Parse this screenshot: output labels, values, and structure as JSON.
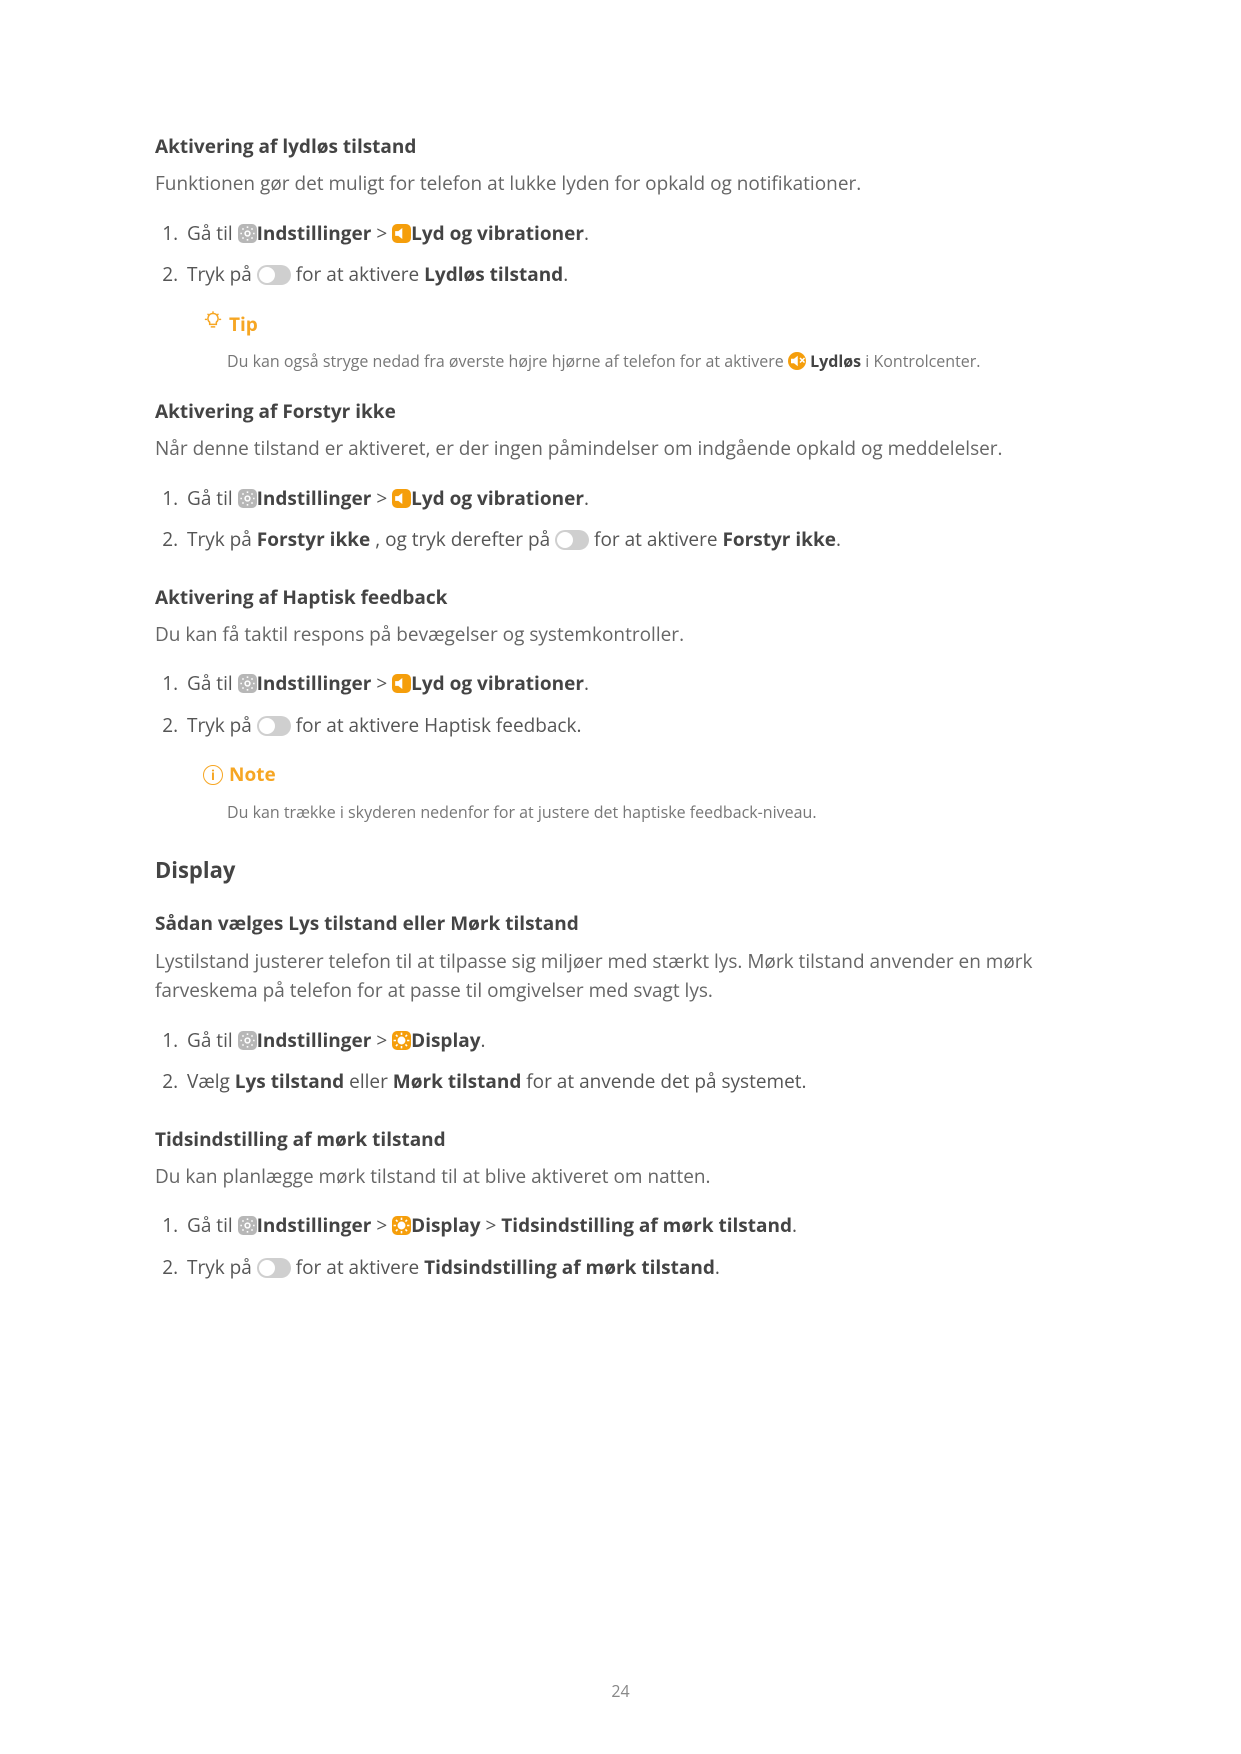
{
  "section1": {
    "heading": "Aktivering af lydløs tilstand",
    "body": "Funktionen gør det muligt for telefon at lukke lyden for opkald og notifikationer.",
    "step1_a": "Gå til ",
    "step1_b": "Indstillinger",
    "step1_sep": " > ",
    "step1_c": "Lyd og vibrationer",
    "step1_end": ".",
    "step2_a": "Tryk på ",
    "step2_b": " for at aktivere ",
    "step2_c": "Lydløs tilstand",
    "step2_end": ".",
    "tip_label": "Tip",
    "tip_a": "Du kan også stryge nedad fra øverste højre hjørne af telefon for at aktivere ",
    "tip_b": "Lydløs",
    "tip_c": " i Kontrolcenter."
  },
  "section2": {
    "heading": "Aktivering af Forstyr ikke",
    "body": "Når denne tilstand er aktiveret, er der ingen påmindelser om indgående opkald og meddelelser.",
    "step1_a": "Gå til ",
    "step1_b": "Indstillinger",
    "step1_sep": " > ",
    "step1_c": "Lyd og vibrationer",
    "step1_end": ".",
    "step2_a": "Tryk på ",
    "step2_b": "Forstyr ikke",
    "step2_c": " , og tryk derefter på ",
    "step2_d": " for at aktivere ",
    "step2_e": "Forstyr ikke",
    "step2_end": "."
  },
  "section3": {
    "heading": "Aktivering af Haptisk feedback",
    "body": "Du kan få taktil respons på bevægelser og systemkontroller.",
    "step1_a": "Gå til ",
    "step1_b": "Indstillinger",
    "step1_sep": " > ",
    "step1_c": "Lyd og vibrationer",
    "step1_end": ".",
    "step2_a": "Tryk på ",
    "step2_b": " for at aktivere Haptisk feedback.",
    "note_label": "Note",
    "note_body": "Du kan trække i skyderen nedenfor for at justere det haptiske feedback-niveau."
  },
  "display": {
    "heading": "Display",
    "sub1_heading": "Sådan vælges Lys tilstand eller Mørk tilstand",
    "sub1_body": "Lystilstand justerer telefon til at tilpasse sig miljøer med stærkt lys. Mørk tilstand anvender en mørk farveskema på telefon for at passe til omgivelser med svagt lys.",
    "sub1_step1_a": "Gå til ",
    "sub1_step1_b": "Indstillinger",
    "sub1_step1_sep": " > ",
    "sub1_step1_c": "Display",
    "sub1_step1_end": ".",
    "sub1_step2_a": "Vælg ",
    "sub1_step2_b": "Lys tilstand",
    "sub1_step2_c": " eller ",
    "sub1_step2_d": "Mørk tilstand",
    "sub1_step2_e": " for at anvende det på systemet.",
    "sub2_heading": "Tidsindstilling af mørk tilstand",
    "sub2_body": "Du kan planlægge mørk tilstand til at blive aktiveret om natten.",
    "sub2_step1_a": "Gå til ",
    "sub2_step1_b": "Indstillinger",
    "sub2_step1_sep": " > ",
    "sub2_step1_c": "Display",
    "sub2_step1_sep2": " > ",
    "sub2_step1_d": "Tidsindstilling af mørk tilstand",
    "sub2_step1_end": ".",
    "sub2_step2_a": "Tryk på ",
    "sub2_step2_b": " for at aktivere ",
    "sub2_step2_c": "Tidsindstilling af mørk tilstand",
    "sub2_step2_end": "."
  },
  "page_number": "24"
}
